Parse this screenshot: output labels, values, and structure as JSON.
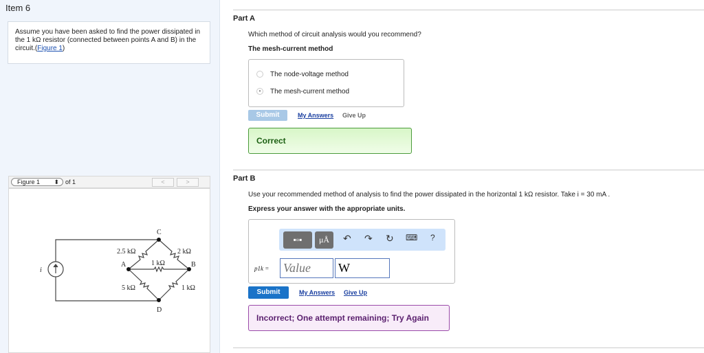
{
  "item_title": "Item 6",
  "prompt": {
    "text": "Assume you have been asked to find the power dissipated in the 1 kΩ resistor (connected between points A and B) in the circuit.(",
    "link": "Figure 1",
    "end": ")"
  },
  "figure_nav": {
    "select": "Figure 1",
    "of": "of 1",
    "prev": "<",
    "next": ">"
  },
  "circuit": {
    "source": "i",
    "nodes": [
      "C",
      "A",
      "B",
      "D"
    ],
    "resistors": [
      "2.5 kΩ",
      "2 kΩ",
      "1 kΩ",
      "5 kΩ",
      "1 kΩ"
    ]
  },
  "partA": {
    "title": "Part A",
    "question": "Which method of circuit analysis would you recommend?",
    "answer": "The mesh-current method",
    "options": [
      "The node-voltage method",
      "The mesh-current method"
    ],
    "selected": 1,
    "submit": "Submit",
    "my_answers": "My Answers",
    "give_up": "Give Up",
    "feedback": "Correct"
  },
  "partB": {
    "title": "Part B",
    "question": "Use your recommended method of analysis to find the power dissipated in the horizontal 1 kΩ resistor. Take i = 30 mA .",
    "instruction": "Express your answer with the appropriate units.",
    "toolbar": {
      "units": "μÅ",
      "help": "?"
    },
    "var_label": "p1k =",
    "value_placeholder": "Value",
    "unit_value": "W",
    "submit": "Submit",
    "my_answers": "My Answers",
    "give_up": "Give Up",
    "feedback": "Incorrect; One attempt remaining; Try Again"
  }
}
